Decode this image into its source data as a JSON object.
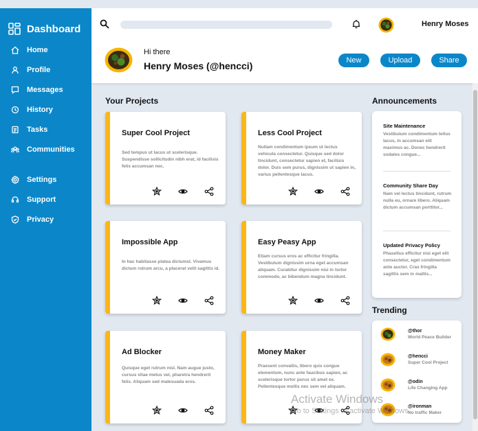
{
  "sidebar": {
    "brand": "Dashboard",
    "items": [
      {
        "label": "Home",
        "icon": "home-icon"
      },
      {
        "label": "Profile",
        "icon": "user-icon"
      },
      {
        "label": "Messages",
        "icon": "message-icon"
      },
      {
        "label": "History",
        "icon": "history-icon"
      },
      {
        "label": "Tasks",
        "icon": "tasks-icon"
      },
      {
        "label": "Communities",
        "icon": "communities-icon"
      }
    ],
    "items2": [
      {
        "label": "Settings",
        "icon": "gear-icon"
      },
      {
        "label": "Support",
        "icon": "headset-icon"
      },
      {
        "label": "Privacy",
        "icon": "shield-icon"
      }
    ]
  },
  "header": {
    "search_placeholder": "",
    "user_name": "Henry Moses"
  },
  "profile": {
    "greeting": "Hi there",
    "handle": "Henry Moses (@hencci)",
    "buttons": {
      "new": "New",
      "upload": "Upload",
      "share": "Share"
    }
  },
  "projects": {
    "title": "Your Projects",
    "items": [
      {
        "title": "Super Cool Project",
        "desc": "Sed tempus ut lacus ut scelerisque. Suspendisse sollicitudin nibh erat, id facilisis felis accumsan nec."
      },
      {
        "title": "Less Cool Project",
        "desc": "Nullam condimentum ipsum ut lectus vehicula consectetur. Quisque sed dolor tincidunt, consectetur sapien et, facilisis dolor. Duis sem purus, dignissim ut sapien in, varius pellentesque lacus."
      },
      {
        "title": "Impossible App",
        "desc": "In hac habitasse platea dictumst. Vivamus dictum rutrum arcu, a placerat velit sagittis id."
      },
      {
        "title": "Easy Peasy App",
        "desc": "Etiam cursus eros ac efficitur fringilla. Vestibulum dignissim urna eget accumsan aliquam. Curabitur dignissim nisi in tortor commodo, ac bibendum magna tincidunt."
      },
      {
        "title": "Ad Blocker",
        "desc": "Quisque eget rutrum nisl. Nam augue justo, cursus vitae metus vel, pharetra hendrerit felis. Aliquam sed malesuada eros."
      },
      {
        "title": "Money Maker",
        "desc": "Praesent convallis, libero quis congue elementum, nunc ante faucibus sapien, ac scelerisque tortor purus sit amet ex. Pellentesque mollis nec sem vel aliquam."
      }
    ]
  },
  "announcements": {
    "title": "Announcements",
    "items": [
      {
        "title": "Site Maintenance",
        "body": "Vestibulum condimentum tellus lacus, in accumsan elit maximus ac. Donec hendrerit sodales congue..."
      },
      {
        "title": "Community Share Day",
        "body": "Nam vel lectus tincidunt, rutrum nulla eu, ornare libero. Aliquam dictum accumsan porttitor..."
      },
      {
        "title": "Updated Privacy Policy",
        "body": "Phasellus efficitur nisi eget elit consectetur, eget condimentum ante auctor. Cras fringilla sagittis sem in mattis..."
      }
    ]
  },
  "trending": {
    "title": "Trending",
    "items": [
      {
        "handle": "@thor",
        "project": "World Peace Builder"
      },
      {
        "handle": "@hencci",
        "project": "Super Cool Project"
      },
      {
        "handle": "@odin",
        "project": "Life Changing App"
      },
      {
        "handle": "@ironman",
        "project": "No traffic Maker"
      }
    ]
  },
  "watermark": {
    "line1": "Activate Windows",
    "line2": "Go to Settings to activate Windows."
  },
  "colors": {
    "sidebar": "#0b87c9",
    "accent": "#fbb617",
    "background": "#e2e8f0"
  }
}
